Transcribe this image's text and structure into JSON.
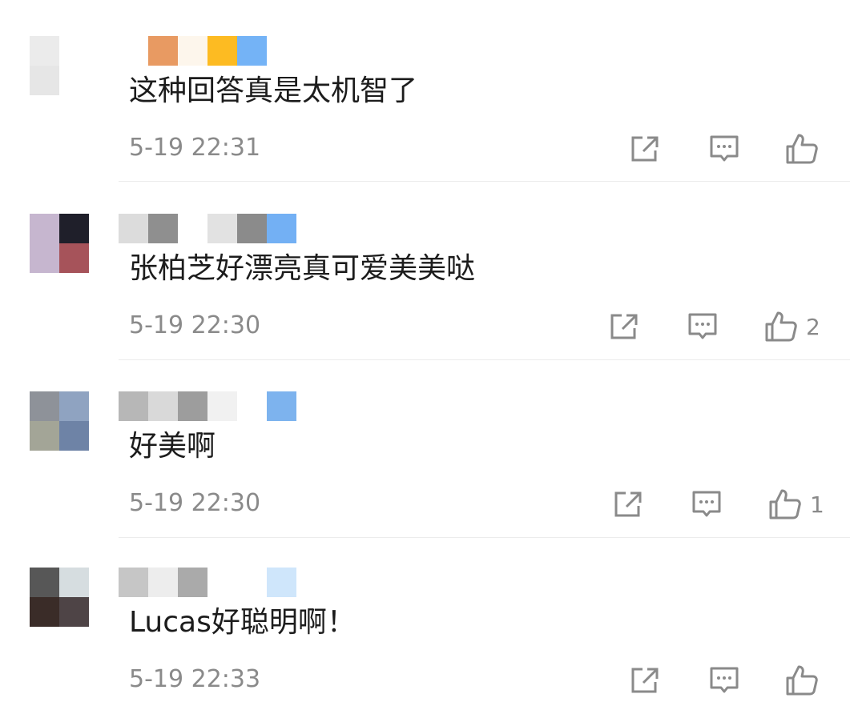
{
  "comments": [
    {
      "avatar_colors": [
        "#ebebeb",
        "#ffffff",
        "#e6e6e6",
        "#ffffff"
      ],
      "nick_colors": [
        "#ffffff",
        "#e89a62",
        "#fdf6ec",
        "#fdbb22",
        "#74b3f6"
      ],
      "text": "这种回答真是太机智了",
      "time": "5-19 22:31",
      "likes": ""
    },
    {
      "avatar_colors": [
        "#c6b6cf",
        "#1f1f2a",
        "#c6b6cf",
        "#a6535a"
      ],
      "nick_colors": [
        "#dcdcdc",
        "#8f8f8f",
        "#ffffff",
        "#e2e2e2",
        "#8b8b8b",
        "#73b0f4"
      ],
      "text": "张柏芝好漂亮真可爱美美哒",
      "time": "5-19 22:30",
      "likes": "2"
    },
    {
      "avatar_colors": [
        "#8e9299",
        "#8fa3c1",
        "#a3a597",
        "#6e83a6"
      ],
      "nick_colors": [
        "#b7b7b7",
        "#d9d9d9",
        "#9d9d9d",
        "#f1f1f1",
        "#ffffff",
        "#7db3ee"
      ],
      "text": "好美啊",
      "time": "5-19 22:30",
      "likes": "1"
    },
    {
      "avatar_colors": [
        "#575757",
        "#d6dde0",
        "#3a2c28",
        "#4e4446"
      ],
      "nick_colors": [
        "#c6c6c6",
        "#ededed",
        "#aaaaaa",
        "#ffffff",
        "#ffffff",
        "#cfe6fb"
      ],
      "text": "Lucas好聪明啊！",
      "time": "5-19 22:33",
      "likes": ""
    }
  ],
  "icons": {
    "share": "share-icon",
    "reply": "comment-icon",
    "like": "thumbs-up-icon"
  }
}
